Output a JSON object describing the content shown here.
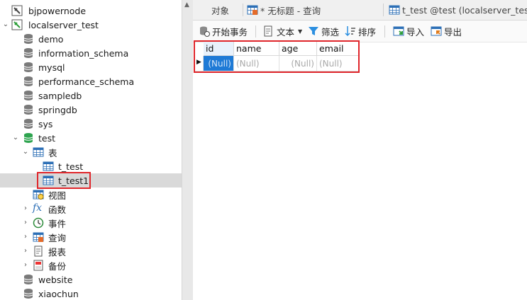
{
  "tree": {
    "items": [
      {
        "label": "bjpowernode",
        "icon": "connection-icon"
      },
      {
        "label": "localserver_test",
        "icon": "connection-icon"
      },
      {
        "label": "demo",
        "icon": "database-icon"
      },
      {
        "label": "information_schema",
        "icon": "database-icon"
      },
      {
        "label": "mysql",
        "icon": "database-icon"
      },
      {
        "label": "performance_schema",
        "icon": "database-icon"
      },
      {
        "label": "sampledb",
        "icon": "database-icon"
      },
      {
        "label": "springdb",
        "icon": "database-icon"
      },
      {
        "label": "sys",
        "icon": "database-icon"
      },
      {
        "label": "test",
        "icon": "database-icon"
      },
      {
        "label": "表",
        "icon": "tables-folder-icon"
      },
      {
        "label": "t_test",
        "icon": "table-icon"
      },
      {
        "label": "t_test1",
        "icon": "table-icon"
      },
      {
        "label": "视图",
        "icon": "view-icon"
      },
      {
        "label": "函数",
        "icon": "function-icon"
      },
      {
        "label": "事件",
        "icon": "event-icon"
      },
      {
        "label": "查询",
        "icon": "query-icon"
      },
      {
        "label": "报表",
        "icon": "report-icon"
      },
      {
        "label": "备份",
        "icon": "backup-icon"
      },
      {
        "label": "website",
        "icon": "database-icon"
      },
      {
        "label": "xiaochun",
        "icon": "database-icon"
      }
    ]
  },
  "tabs": {
    "objects": "对象",
    "query": "* 无标题 - 查询",
    "table": "t_test @test (localserver_tes..."
  },
  "toolbar": {
    "begin_transaction": "开始事务",
    "text": "文本",
    "filter": "筛选",
    "sort": "排序",
    "import": "导入",
    "export": "导出"
  },
  "grid": {
    "columns": [
      "id",
      "name",
      "age",
      "email"
    ],
    "row": [
      "(Null)",
      "(Null)",
      "(Null)",
      "(Null)"
    ]
  },
  "colors": {
    "highlight": "#e0262b",
    "selected_cell": "#1e7ad6",
    "db_active": "#2ea44f"
  }
}
